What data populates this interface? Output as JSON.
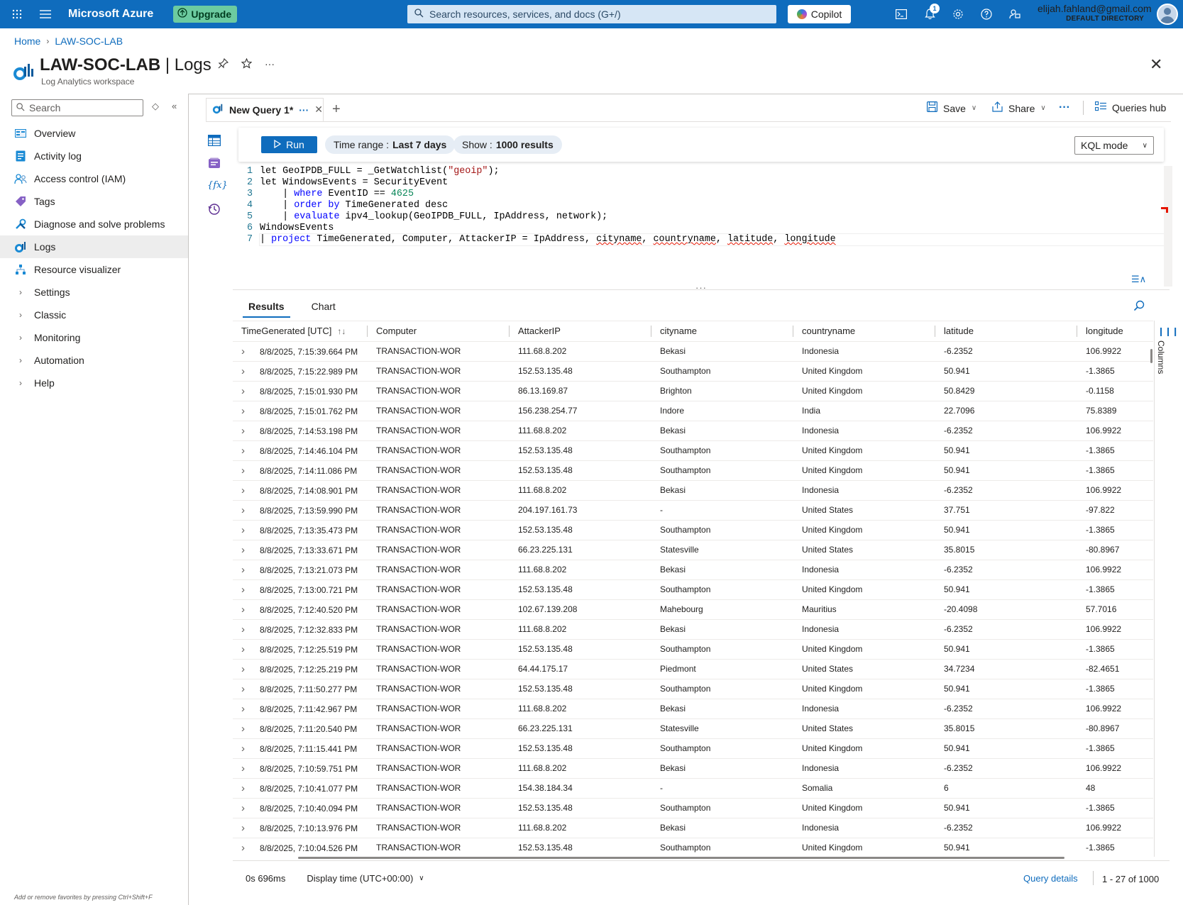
{
  "topbar": {
    "brand": "Microsoft Azure",
    "upgrade": "Upgrade",
    "search_placeholder": "Search resources, services, and docs (G+/)",
    "copilot": "Copilot",
    "notification_count": "1",
    "user_email": "elijah.fahland@gmail.com",
    "user_directory": "DEFAULT DIRECTORY"
  },
  "breadcrumb": {
    "home": "Home",
    "resource": "LAW-SOC-LAB"
  },
  "header": {
    "title_main": "LAW-SOC-LAB",
    "title_sep": " | ",
    "title_page": "Logs",
    "subtitle": "Log Analytics workspace"
  },
  "sidebar": {
    "search_placeholder": "Search",
    "items": [
      {
        "label": "Overview",
        "icon": "overview-icon"
      },
      {
        "label": "Activity log",
        "icon": "activity-log-icon"
      },
      {
        "label": "Access control (IAM)",
        "icon": "people-icon"
      },
      {
        "label": "Tags",
        "icon": "tag-icon"
      },
      {
        "label": "Diagnose and solve problems",
        "icon": "wrench-icon"
      },
      {
        "label": "Logs",
        "icon": "logs-icon",
        "active": true
      },
      {
        "label": "Resource visualizer",
        "icon": "visualizer-icon"
      },
      {
        "label": "Settings",
        "icon": "chevron-right-icon"
      },
      {
        "label": "Classic",
        "icon": "chevron-right-icon"
      },
      {
        "label": "Monitoring",
        "icon": "chevron-right-icon"
      },
      {
        "label": "Automation",
        "icon": "chevron-right-icon"
      },
      {
        "label": "Help",
        "icon": "chevron-right-icon"
      }
    ],
    "footer": "Add or remove favorites by pressing Ctrl+Shift+F"
  },
  "query_tab": {
    "label": "New Query 1*"
  },
  "toolbar": {
    "save": "Save",
    "share": "Share",
    "queries_hub": "Queries hub"
  },
  "query_bar": {
    "run": "Run",
    "time_range_label": "Time range :",
    "time_range_value": "Last 7 days",
    "show_label": "Show :",
    "show_value": "1000 results",
    "mode": "KQL mode"
  },
  "results_tabs": {
    "results": "Results",
    "chart": "Chart"
  },
  "columns_label": "Columns",
  "table": {
    "headers": [
      "TimeGenerated [UTC]",
      "Computer",
      "AttackerIP",
      "cityname",
      "countryname",
      "latitude",
      "longitude"
    ],
    "rows": [
      [
        "8/8/2025, 7:15:39.664 PM",
        "TRANSACTION-WOR",
        "111.68.8.202",
        "Bekasi",
        "Indonesia",
        "-6.2352",
        "106.9922"
      ],
      [
        "8/8/2025, 7:15:22.989 PM",
        "TRANSACTION-WOR",
        "152.53.135.48",
        "Southampton",
        "United Kingdom",
        "50.941",
        "-1.3865"
      ],
      [
        "8/8/2025, 7:15:01.930 PM",
        "TRANSACTION-WOR",
        "86.13.169.87",
        "Brighton",
        "United Kingdom",
        "50.8429",
        "-0.1158"
      ],
      [
        "8/8/2025, 7:15:01.762 PM",
        "TRANSACTION-WOR",
        "156.238.254.77",
        "Indore",
        "India",
        "22.7096",
        "75.8389"
      ],
      [
        "8/8/2025, 7:14:53.198 PM",
        "TRANSACTION-WOR",
        "111.68.8.202",
        "Bekasi",
        "Indonesia",
        "-6.2352",
        "106.9922"
      ],
      [
        "8/8/2025, 7:14:46.104 PM",
        "TRANSACTION-WOR",
        "152.53.135.48",
        "Southampton",
        "United Kingdom",
        "50.941",
        "-1.3865"
      ],
      [
        "8/8/2025, 7:14:11.086 PM",
        "TRANSACTION-WOR",
        "152.53.135.48",
        "Southampton",
        "United Kingdom",
        "50.941",
        "-1.3865"
      ],
      [
        "8/8/2025, 7:14:08.901 PM",
        "TRANSACTION-WOR",
        "111.68.8.202",
        "Bekasi",
        "Indonesia",
        "-6.2352",
        "106.9922"
      ],
      [
        "8/8/2025, 7:13:59.990 PM",
        "TRANSACTION-WOR",
        "204.197.161.73",
        "-",
        "United States",
        "37.751",
        "-97.822"
      ],
      [
        "8/8/2025, 7:13:35.473 PM",
        "TRANSACTION-WOR",
        "152.53.135.48",
        "Southampton",
        "United Kingdom",
        "50.941",
        "-1.3865"
      ],
      [
        "8/8/2025, 7:13:33.671 PM",
        "TRANSACTION-WOR",
        "66.23.225.131",
        "Statesville",
        "United States",
        "35.8015",
        "-80.8967"
      ],
      [
        "8/8/2025, 7:13:21.073 PM",
        "TRANSACTION-WOR",
        "111.68.8.202",
        "Bekasi",
        "Indonesia",
        "-6.2352",
        "106.9922"
      ],
      [
        "8/8/2025, 7:13:00.721 PM",
        "TRANSACTION-WOR",
        "152.53.135.48",
        "Southampton",
        "United Kingdom",
        "50.941",
        "-1.3865"
      ],
      [
        "8/8/2025, 7:12:40.520 PM",
        "TRANSACTION-WOR",
        "102.67.139.208",
        "Mahebourg",
        "Mauritius",
        "-20.4098",
        "57.7016"
      ],
      [
        "8/8/2025, 7:12:32.833 PM",
        "TRANSACTION-WOR",
        "111.68.8.202",
        "Bekasi",
        "Indonesia",
        "-6.2352",
        "106.9922"
      ],
      [
        "8/8/2025, 7:12:25.519 PM",
        "TRANSACTION-WOR",
        "152.53.135.48",
        "Southampton",
        "United Kingdom",
        "50.941",
        "-1.3865"
      ],
      [
        "8/8/2025, 7:12:25.219 PM",
        "TRANSACTION-WOR",
        "64.44.175.17",
        "Piedmont",
        "United States",
        "34.7234",
        "-82.4651"
      ],
      [
        "8/8/2025, 7:11:50.277 PM",
        "TRANSACTION-WOR",
        "152.53.135.48",
        "Southampton",
        "United Kingdom",
        "50.941",
        "-1.3865"
      ],
      [
        "8/8/2025, 7:11:42.967 PM",
        "TRANSACTION-WOR",
        "111.68.8.202",
        "Bekasi",
        "Indonesia",
        "-6.2352",
        "106.9922"
      ],
      [
        "8/8/2025, 7:11:20.540 PM",
        "TRANSACTION-WOR",
        "66.23.225.131",
        "Statesville",
        "United States",
        "35.8015",
        "-80.8967"
      ],
      [
        "8/8/2025, 7:11:15.441 PM",
        "TRANSACTION-WOR",
        "152.53.135.48",
        "Southampton",
        "United Kingdom",
        "50.941",
        "-1.3865"
      ],
      [
        "8/8/2025, 7:10:59.751 PM",
        "TRANSACTION-WOR",
        "111.68.8.202",
        "Bekasi",
        "Indonesia",
        "-6.2352",
        "106.9922"
      ],
      [
        "8/8/2025, 7:10:41.077 PM",
        "TRANSACTION-WOR",
        "154.38.184.34",
        "-",
        "Somalia",
        "6",
        "48"
      ],
      [
        "8/8/2025, 7:10:40.094 PM",
        "TRANSACTION-WOR",
        "152.53.135.48",
        "Southampton",
        "United Kingdom",
        "50.941",
        "-1.3865"
      ],
      [
        "8/8/2025, 7:10:13.976 PM",
        "TRANSACTION-WOR",
        "111.68.8.202",
        "Bekasi",
        "Indonesia",
        "-6.2352",
        "106.9922"
      ],
      [
        "8/8/2025, 7:10:04.526 PM",
        "TRANSACTION-WOR",
        "152.53.135.48",
        "Southampton",
        "United Kingdom",
        "50.941",
        "-1.3865"
      ]
    ]
  },
  "footer": {
    "duration": "0s 696ms",
    "display_time": "Display time (UTC+00:00)",
    "query_details": "Query details",
    "count": "1 - 27 of 1000"
  }
}
